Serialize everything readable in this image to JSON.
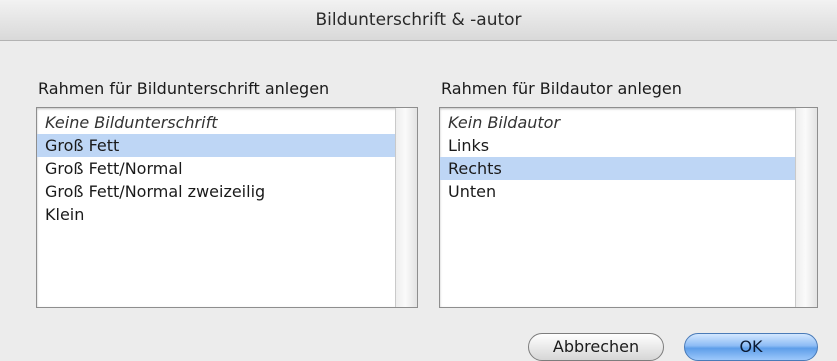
{
  "dialog": {
    "title": "Bildunterschrift & -autor"
  },
  "caption_frame": {
    "label": "Rahmen für Bildunterschrift anlegen",
    "items": [
      {
        "label": "Keine Bildunterschrift",
        "italic": true,
        "selected": false
      },
      {
        "label": "Groß Fett",
        "italic": false,
        "selected": true
      },
      {
        "label": "Groß Fett/Normal",
        "italic": false,
        "selected": false
      },
      {
        "label": "Groß Fett/Normal zweizeilig",
        "italic": false,
        "selected": false
      },
      {
        "label": "Klein",
        "italic": false,
        "selected": false
      }
    ]
  },
  "author_frame": {
    "label": "Rahmen für Bildautor anlegen",
    "items": [
      {
        "label": "Kein Bildautor",
        "italic": true,
        "selected": false
      },
      {
        "label": "Links",
        "italic": false,
        "selected": false
      },
      {
        "label": "Rechts",
        "italic": false,
        "selected": true
      },
      {
        "label": "Unten",
        "italic": false,
        "selected": false
      }
    ]
  },
  "buttons": {
    "cancel_label": "Abbrechen",
    "ok_label": "OK"
  },
  "colors": {
    "selection": "#bed6f5",
    "default_button": "#8dbcf5"
  }
}
